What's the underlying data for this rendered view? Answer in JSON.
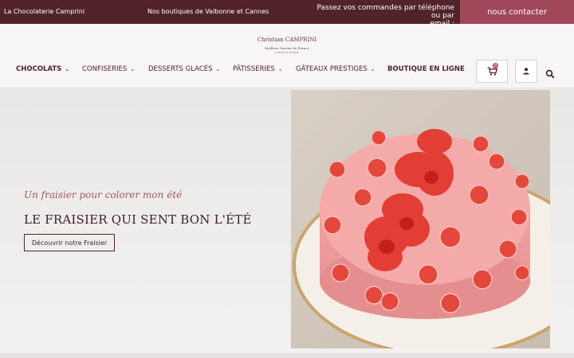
{
  "topbar": {
    "brand": "La Chocolaterie Camprini",
    "shops": "Nos boutiques de Valbonne et Cannes",
    "order_line1": "Passez vos commandes par téléphone ou par",
    "order_line2": "email :",
    "contact_label": "nous contacter"
  },
  "logo": {
    "name": "Christian CAMPRINI",
    "tagline": "Meilleur Ouvrier de France",
    "sub": "CHOCOLATIER"
  },
  "nav": [
    {
      "label": "CHOCOLATS",
      "chevron": "⌄"
    },
    {
      "label": "CONFISERIES",
      "chevron": "⌄"
    },
    {
      "label": "DESSERTS GLACÉS",
      "chevron": "⌄"
    },
    {
      "label": "PÂTISSERIES",
      "chevron": "⌄"
    },
    {
      "label": "GÂTEAUX PRESTIGES",
      "chevron": "⌄"
    },
    {
      "label": "BOUTIQUE EN LIGNE"
    }
  ],
  "cart": {
    "count": "0",
    "icon": "cart-icon"
  },
  "account": {
    "icon": "user-icon"
  },
  "search": {
    "icon": "search-icon"
  },
  "hero": {
    "subtitle": "Un fraisier pour colorer mon été",
    "title": "LE FRAISIER QUI SENT BON L'ÉTÉ",
    "button": "Découvrir notre Fraisier"
  },
  "colors": {
    "topbar": "#52232a",
    "cta": "#a0485a",
    "accent": "#c24a56"
  }
}
